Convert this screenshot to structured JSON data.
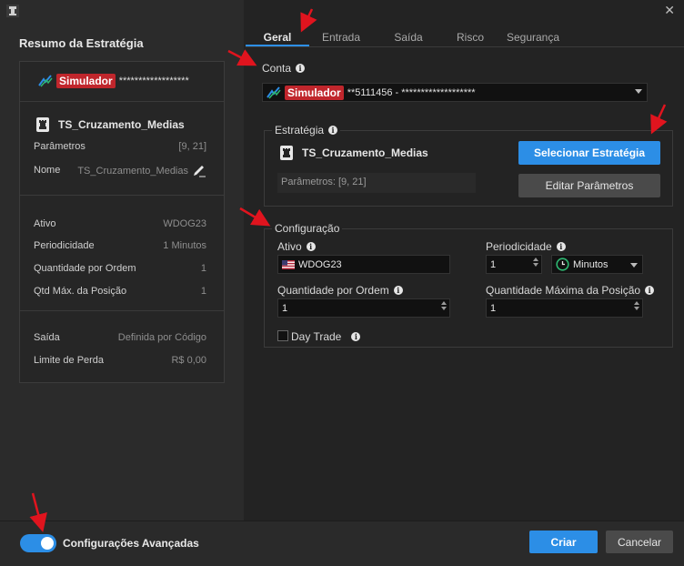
{
  "window": {
    "close_glyph": "✕"
  },
  "summary": {
    "title": "Resumo da Estratégia",
    "account_badge": "Simulador",
    "account_mask": "******************",
    "strategy_name": "TS_Cruzamento_Medias",
    "rows_top": [
      {
        "key": "Parâmetros",
        "value": "[9, 21]"
      },
      {
        "key": "Nome",
        "value": "TS_Cruzamento_Medias"
      }
    ],
    "rows_mid": [
      {
        "key": "Ativo",
        "value": "WDOG23"
      },
      {
        "key": "Periodicidade",
        "value": "1 Minutos"
      },
      {
        "key": "Quantidade por Ordem",
        "value": "1"
      },
      {
        "key": "Qtd Máx. da Posição",
        "value": "1"
      }
    ],
    "rows_bot": [
      {
        "key": "Saída",
        "value": "Definida por Código"
      },
      {
        "key": "Limite de Perda",
        "value": "R$ 0,00"
      }
    ]
  },
  "tabs": [
    {
      "label": "Geral",
      "active": true
    },
    {
      "label": "Entrada",
      "active": false
    },
    {
      "label": "Saída",
      "active": false
    },
    {
      "label": "Risco",
      "active": false
    },
    {
      "label": "Segurança",
      "active": false
    }
  ],
  "conta": {
    "label": "Conta",
    "badge": "Simulador",
    "value": "**5111456 - *******************"
  },
  "estrategia": {
    "label": "Estratégia",
    "name": "TS_Cruzamento_Medias",
    "params": "Parâmetros: [9, 21]",
    "select_button": "Selecionar Estratégia",
    "edit_button": "Editar Parâmetros"
  },
  "configuracao": {
    "label": "Configuração",
    "ativo_label": "Ativo",
    "ativo_value": "WDOG23",
    "periodicidade_label": "Periodicidade",
    "periodicidade_value": "1",
    "periodicidade_unit": "Minutos",
    "qtd_ordem_label": "Quantidade por Ordem",
    "qtd_ordem_value": "1",
    "qtd_max_label": "Quantidade Máxima da Posição",
    "qtd_max_value": "1",
    "day_trade_label": "Day Trade",
    "day_trade_checked": false
  },
  "footer": {
    "toggle_label": "Configurações Avançadas",
    "toggle_on": true,
    "create_button": "Criar",
    "cancel_button": "Cancelar"
  },
  "colors": {
    "accent": "#2c8ee6",
    "badge": "#c0262c",
    "annotation_arrow": "#e0141e"
  }
}
